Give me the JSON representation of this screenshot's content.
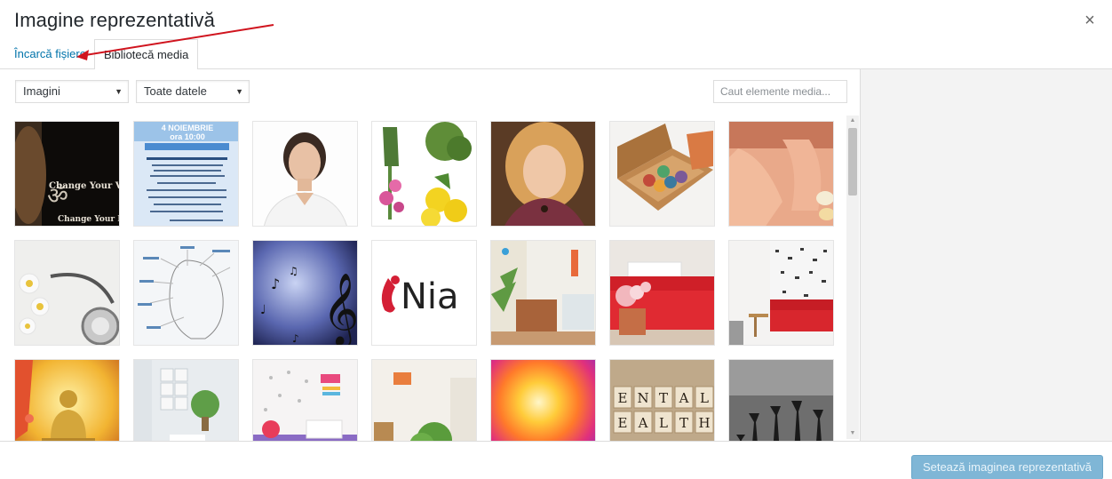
{
  "modal": {
    "title": "Imagine reprezentativă",
    "close_symbol": "×"
  },
  "tabs": [
    {
      "label": "Încarcă fișiere"
    },
    {
      "label": "Bibliotecă media"
    }
  ],
  "toolbar": {
    "filter_type": "Imagini",
    "filter_date": "Toate datele",
    "search_placeholder": "Caut elemente media..."
  },
  "thumbnails": {
    "row1_col1_caption_top": "Change Your Vibr",
    "row1_col1_caption_bottom": "Change Your L",
    "row1_col2_date": "4 NOIEMBRIE",
    "row1_col2_time": "ora 10:00",
    "row2_col4_logo": "Nia",
    "row3_col6_letters": [
      "E",
      "N",
      "T",
      "A",
      "L",
      "E",
      "A",
      "L",
      "T",
      "H"
    ]
  },
  "footer": {
    "set_button": "Setează imaginea reprezentativă"
  },
  "colors": {
    "link": "#0073aa",
    "primary_button": "#7fb6d6",
    "annotation_arrow": "#d0141e"
  }
}
